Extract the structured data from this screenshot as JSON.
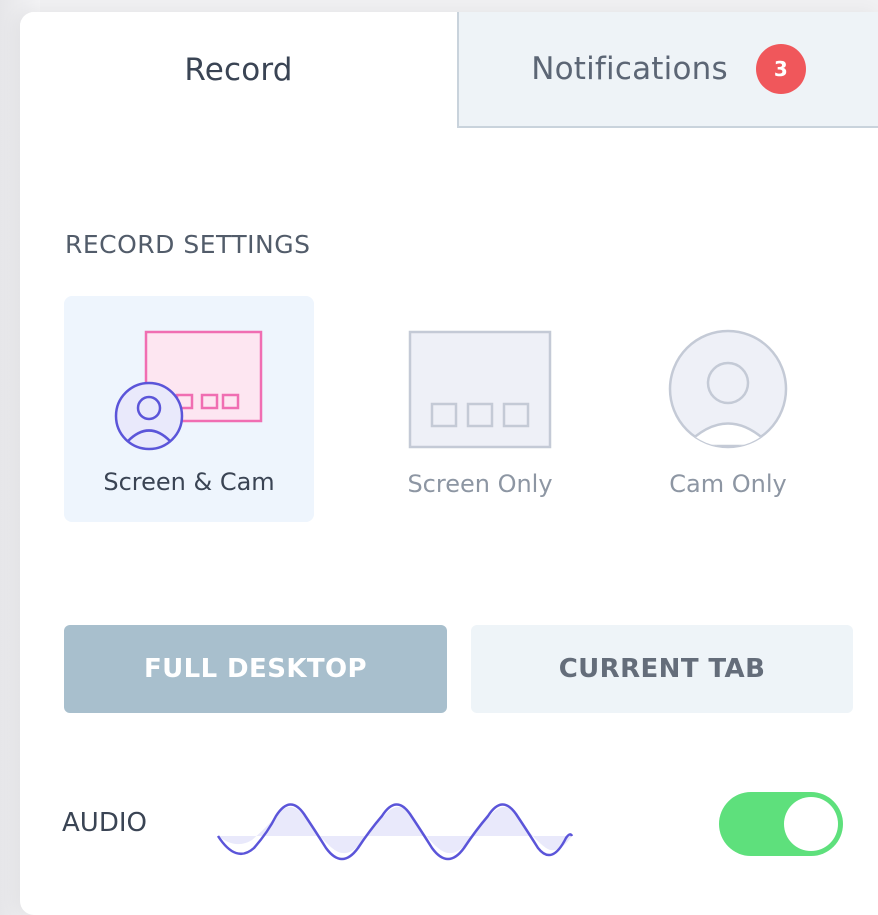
{
  "tabs": {
    "record_label": "Record",
    "notifications_label": "Notifications",
    "notifications_count": "3"
  },
  "record_settings": {
    "title": "RECORD SETTINGS",
    "modes": [
      {
        "label": "Screen & Cam",
        "icon": "screen-and-cam-icon",
        "selected": true
      },
      {
        "label": "Screen Only",
        "icon": "screen-only-icon",
        "selected": false
      },
      {
        "label": "Cam Only",
        "icon": "cam-only-icon",
        "selected": false
      }
    ],
    "sources": {
      "full_desktop_label": "FULL DESKTOP",
      "current_tab_label": "CURRENT TAB",
      "selected": "FULL DESKTOP"
    },
    "audio": {
      "label": "AUDIO",
      "enabled": true
    }
  },
  "colors": {
    "accent_pink": "#f06eb2",
    "accent_purple": "#5b55d9",
    "badge_red": "#f0575b",
    "toggle_green": "#5ee07c",
    "selected_button": "#a8bfcd"
  }
}
